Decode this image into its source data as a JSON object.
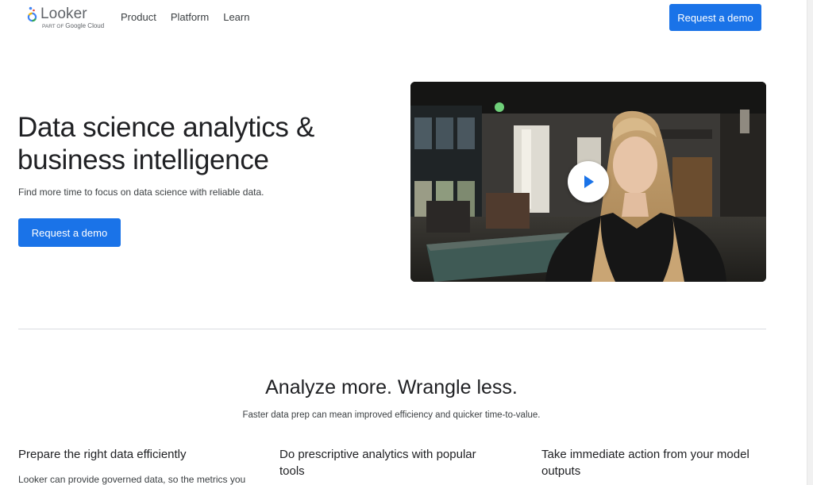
{
  "header": {
    "logo_text": "Looker",
    "logo_sub_prefix": "PART OF",
    "logo_sub_brand": "Google Cloud",
    "nav": [
      "Product",
      "Platform",
      "Learn"
    ],
    "cta_label": "Request a demo"
  },
  "hero": {
    "title_line1": "Data science analytics &",
    "title_line2": "business intelligence",
    "subtitle": "Find more time to focus on data science with reliable data.",
    "cta_label": "Request a demo"
  },
  "video": {
    "play_icon": "play-icon"
  },
  "section": {
    "title": "Analyze more. Wrangle less.",
    "subtitle": "Faster data prep can mean improved efficiency and quicker time-to-value.",
    "features": [
      {
        "title": "Prepare the right data efficiently",
        "body": "Looker can provide governed data, so the metrics you"
      },
      {
        "title": "Do prescriptive analytics with popular tools",
        "body": ""
      },
      {
        "title": "Take immediate action from your model outputs",
        "body": ""
      }
    ]
  },
  "colors": {
    "accent": "#1a73e8",
    "text": "#202124",
    "divider": "#dadce0"
  }
}
